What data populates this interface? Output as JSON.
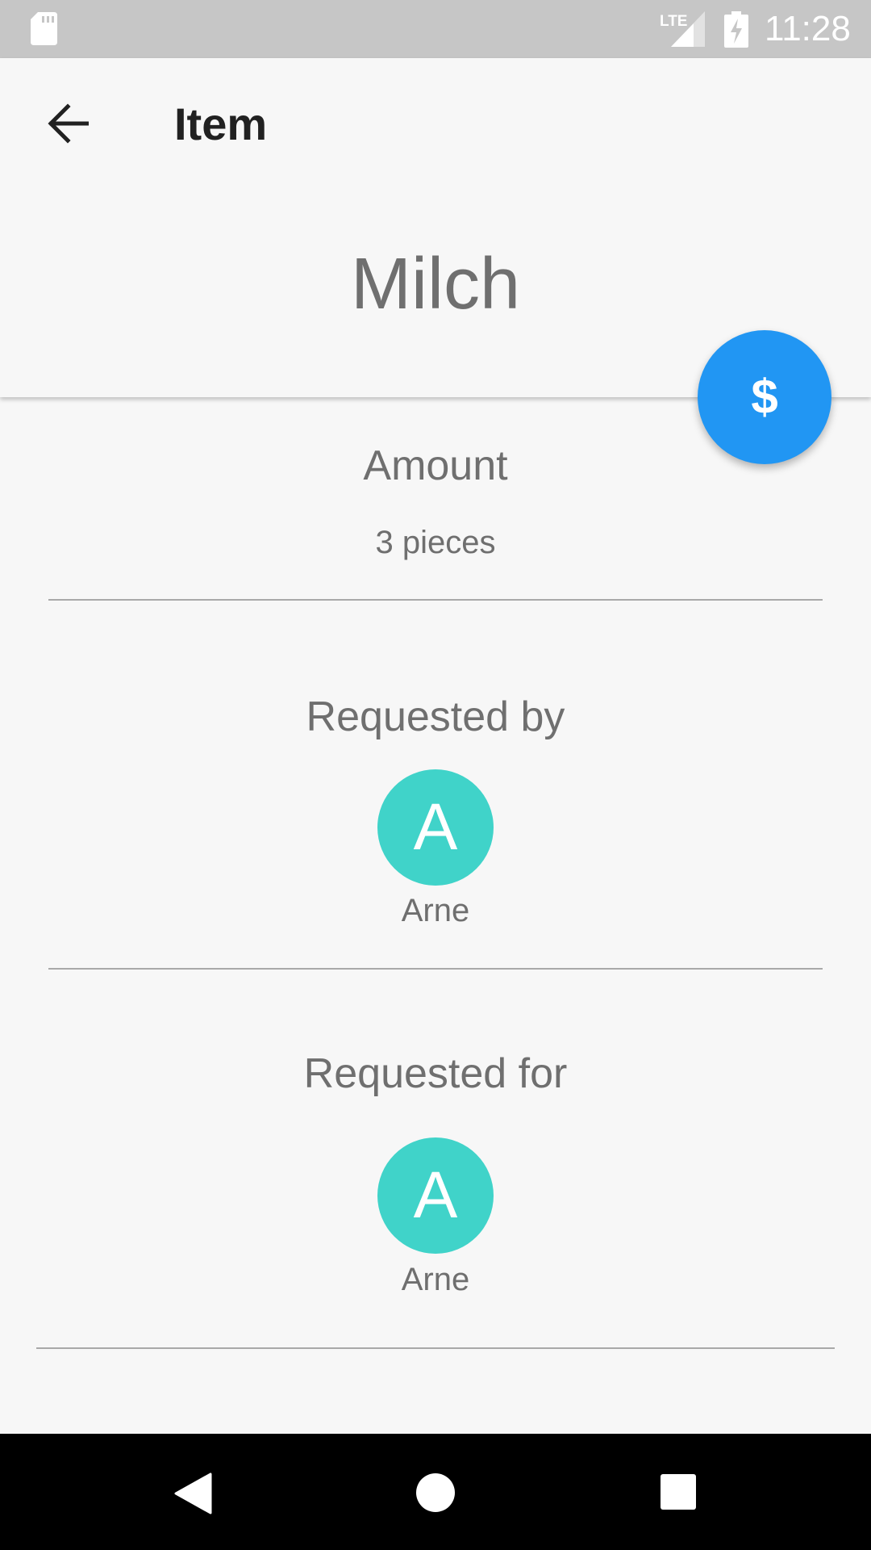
{
  "status_bar": {
    "time": "11:28",
    "icons": [
      "sd-card-icon",
      "lte-signal-icon",
      "battery-charging-icon"
    ],
    "background_color": "#c6c6c6"
  },
  "toolbar": {
    "title": "Item",
    "back_icon": "arrow-back-icon"
  },
  "item": {
    "name": "Milch"
  },
  "fab": {
    "label": "$",
    "color": "#2196f3"
  },
  "amount": {
    "title": "Amount",
    "value": "3 pieces"
  },
  "requested_by": {
    "title": "Requested by",
    "avatar_letter": "A",
    "name": "Arne",
    "avatar_color": "#40d3c9"
  },
  "requested_for": {
    "title": "Requested for",
    "avatar_letter": "A",
    "name": "Arne",
    "avatar_color": "#40d3c9"
  },
  "navigation_bar": {
    "icons": [
      "nav-back-icon",
      "nav-home-icon",
      "nav-recents-icon"
    ]
  }
}
